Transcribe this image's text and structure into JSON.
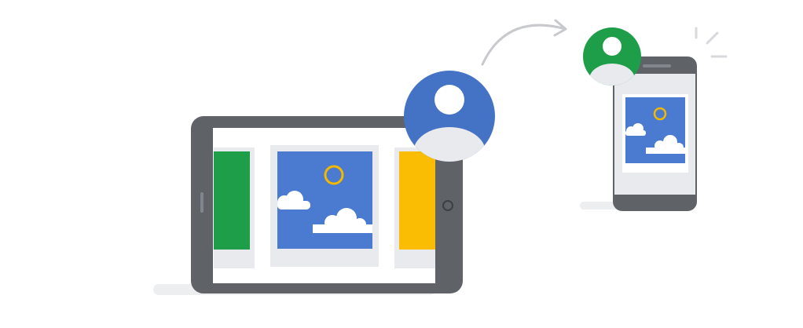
{
  "illustration": {
    "theme": "share photo from tablet to phone",
    "icons": {
      "tablet": "tablet-device-icon",
      "phone": "phone-device-icon",
      "sender_avatar": "person-avatar-icon",
      "recipient_avatar": "person-avatar-icon",
      "arrow": "curved-arrow-icon",
      "notification": "notification-burst-icon",
      "photo": "landscape-photo-icon"
    },
    "colors": {
      "device_frame": "#5f6368",
      "screen": "#ffffff",
      "card_background": "#e8eaed",
      "photo_sky": "#4a7bd0",
      "sun_ring": "#f5b800",
      "cloud": "#ffffff",
      "card_green": "#1e9e48",
      "card_yellow": "#fbbc04",
      "avatar_blue": "#4472c4",
      "avatar_green": "#1e9e48",
      "arrow": "#c7c9cc",
      "shadow": "#eceef0",
      "notification_lines": "#d7d9dc"
    }
  }
}
